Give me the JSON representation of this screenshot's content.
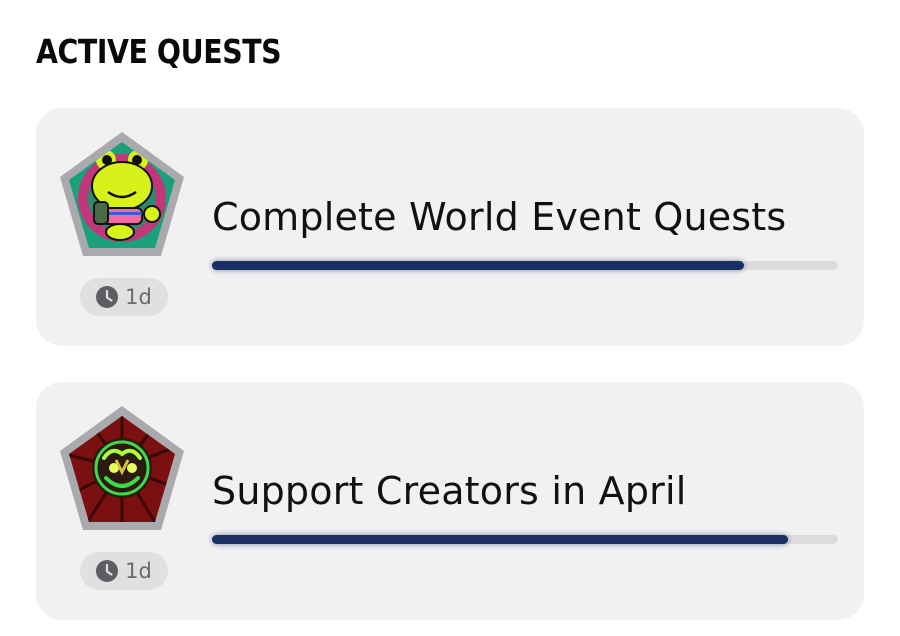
{
  "section": {
    "title": "ACTIVE QUESTS"
  },
  "quests": [
    {
      "title": "Complete World Event Quests",
      "time_remaining": "1d",
      "progress": 0.85,
      "badge_icon": "frog-character-badge-icon",
      "colors": {
        "badge_bg": "#1aa07a",
        "badge_frame": "#a9a9ae"
      }
    },
    {
      "title": "Support Creators in April",
      "time_remaining": "1d",
      "progress": 0.92,
      "badge_icon": "neon-creature-badge-icon",
      "colors": {
        "badge_bg": "#7a1010",
        "badge_frame": "#a9a9ae"
      }
    }
  ],
  "colors": {
    "card_bg": "#f1f1f2",
    "progress_fill": "#1a2f66",
    "progress_track": "#dcdcde",
    "timer_pill_bg": "#e0e0e2",
    "timer_text": "#6a6a6e"
  },
  "icons": {
    "timer": "clock-icon"
  }
}
